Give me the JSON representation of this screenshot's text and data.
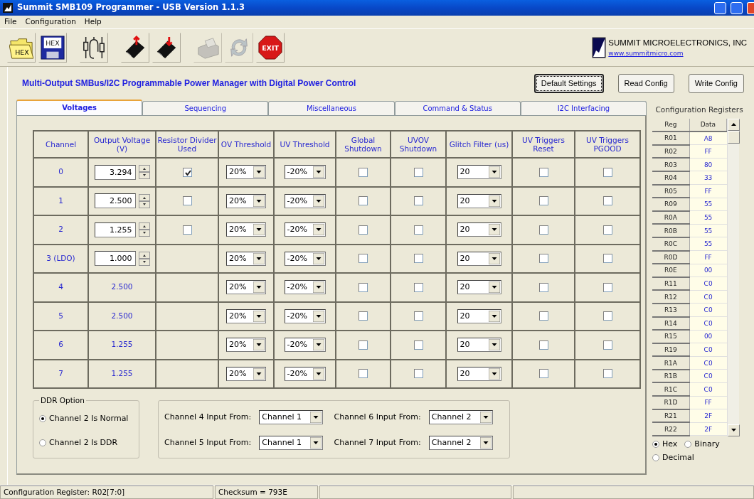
{
  "window": {
    "title": "Summit SMB109 Programmer - USB Version 1.1.3"
  },
  "menu": [
    "File",
    "Configuration",
    "Help"
  ],
  "toolbar": [
    {
      "kind": "open-hex",
      "label": "HEX",
      "disabled": false
    },
    {
      "kind": "save-hex",
      "label": "HEX",
      "disabled": false
    },
    {
      "kind": "circuit",
      "disabled": false
    },
    {
      "kind": "chip-up",
      "disabled": false
    },
    {
      "kind": "chip-down",
      "disabled": false
    },
    {
      "kind": "printer",
      "disabled": true
    },
    {
      "kind": "refresh",
      "disabled": true
    },
    {
      "kind": "exit",
      "label": "EXIT",
      "disabled": false
    }
  ],
  "company": {
    "name": "SUMMIT MICROELECTRONICS, INC",
    "url": "www.summitmicro.com"
  },
  "heading": "Multi-Output SMBus/I2C Programmable Power Manager with Digital Power Control",
  "buttons": [
    {
      "label": "Default Settings",
      "focused": true
    },
    {
      "label": "Read Config",
      "focused": false
    },
    {
      "label": "Write Config",
      "focused": false
    }
  ],
  "tabs": [
    {
      "label": "Voltages",
      "selected": true
    },
    {
      "label": "Sequencing",
      "selected": false
    },
    {
      "label": "Miscellaneous",
      "selected": false
    },
    {
      "label": "Command & Status",
      "selected": false
    },
    {
      "label": "I2C Interfacing",
      "selected": false
    }
  ],
  "table": {
    "columns": [
      "Channel",
      "Output Voltage (V)",
      "Resistor Divider Used",
      "OV Threshold",
      "UV Threshold",
      "Global Shutdown",
      "UVOV Shutdown",
      "Glitch Filter (us)",
      "UV Triggers Reset",
      "UV Triggers PGOOD"
    ],
    "rows": [
      {
        "channel": "0",
        "voltage": "3.294",
        "kind": "spin",
        "divider": true,
        "ov": "20%",
        "uv": "-20%",
        "global_shutdown": false,
        "uvov_shutdown": false,
        "glitch": "20",
        "uv_reset": false,
        "uv_pgood": false
      },
      {
        "channel": "1",
        "voltage": "2.500",
        "kind": "spin",
        "divider": false,
        "ov": "20%",
        "uv": "-20%",
        "global_shutdown": false,
        "uvov_shutdown": false,
        "glitch": "20",
        "uv_reset": false,
        "uv_pgood": false
      },
      {
        "channel": "2",
        "voltage": "1.255",
        "kind": "spin",
        "divider": false,
        "ov": "20%",
        "uv": "-20%",
        "global_shutdown": false,
        "uvov_shutdown": false,
        "glitch": "20",
        "uv_reset": false,
        "uv_pgood": false
      },
      {
        "channel": "3 (LDO)",
        "voltage": "1.000",
        "kind": "spin",
        "ov": "20%",
        "uv": "-20%",
        "global_shutdown": false,
        "uvov_shutdown": false,
        "glitch": "20",
        "uv_reset": false,
        "uv_pgood": false
      },
      {
        "channel": "4",
        "voltage": "2.500",
        "kind": "text",
        "ov": "20%",
        "uv": "-20%",
        "global_shutdown": false,
        "uvov_shutdown": false,
        "glitch": "20",
        "uv_reset": false,
        "uv_pgood": false
      },
      {
        "channel": "5",
        "voltage": "2.500",
        "kind": "text",
        "ov": "20%",
        "uv": "-20%",
        "global_shutdown": false,
        "uvov_shutdown": false,
        "glitch": "20",
        "uv_reset": false,
        "uv_pgood": false
      },
      {
        "channel": "6",
        "voltage": "1.255",
        "kind": "text",
        "ov": "20%",
        "uv": "-20%",
        "global_shutdown": false,
        "uvov_shutdown": false,
        "glitch": "20",
        "uv_reset": false,
        "uv_pgood": false
      },
      {
        "channel": "7",
        "voltage": "1.255",
        "kind": "text",
        "ov": "20%",
        "uv": "-20%",
        "global_shutdown": false,
        "uvov_shutdown": false,
        "glitch": "20",
        "uv_reset": false,
        "uv_pgood": false
      }
    ]
  },
  "ddr": {
    "title": "DDR Option",
    "options": [
      {
        "label": "Channel 2 Is Normal",
        "selected": true
      },
      {
        "label": "Channel 2 Is DDR",
        "selected": false
      }
    ]
  },
  "inputs": [
    {
      "label": "Channel 4 Input From:",
      "value": "Channel 1"
    },
    {
      "label": "Channel 6 Input From:",
      "value": "Channel 2"
    },
    {
      "label": "Channel 5 Input From:",
      "value": "Channel 1"
    },
    {
      "label": "Channel 7 Input From:",
      "value": "Channel 2"
    }
  ],
  "registers": {
    "title": "Configuration Registers",
    "columns": [
      "Reg",
      "Data"
    ],
    "rows": [
      [
        "R01",
        "A8"
      ],
      [
        "R02",
        "FF"
      ],
      [
        "R03",
        "80"
      ],
      [
        "R04",
        "33"
      ],
      [
        "R05",
        "FF"
      ],
      [
        "R09",
        "55"
      ],
      [
        "R0A",
        "55"
      ],
      [
        "R0B",
        "55"
      ],
      [
        "R0C",
        "55"
      ],
      [
        "R0D",
        "FF"
      ],
      [
        "R0E",
        "00"
      ],
      [
        "R11",
        "C0"
      ],
      [
        "R12",
        "C0"
      ],
      [
        "R13",
        "C0"
      ],
      [
        "R14",
        "C0"
      ],
      [
        "R15",
        "00"
      ],
      [
        "R19",
        "C0"
      ],
      [
        "R1A",
        "C0"
      ],
      [
        "R1B",
        "C0"
      ],
      [
        "R1C",
        "C0"
      ],
      [
        "R1D",
        "FF"
      ],
      [
        "R21",
        "2F"
      ],
      [
        "R22",
        "2F"
      ]
    ],
    "formats": [
      {
        "label": "Hex",
        "selected": true
      },
      {
        "label": "Binary",
        "selected": false
      },
      {
        "label": "Decimal",
        "selected": false
      }
    ]
  },
  "status_bar": [
    "Configuration Register: R02[7:0]",
    "Checksum = 793E"
  ]
}
